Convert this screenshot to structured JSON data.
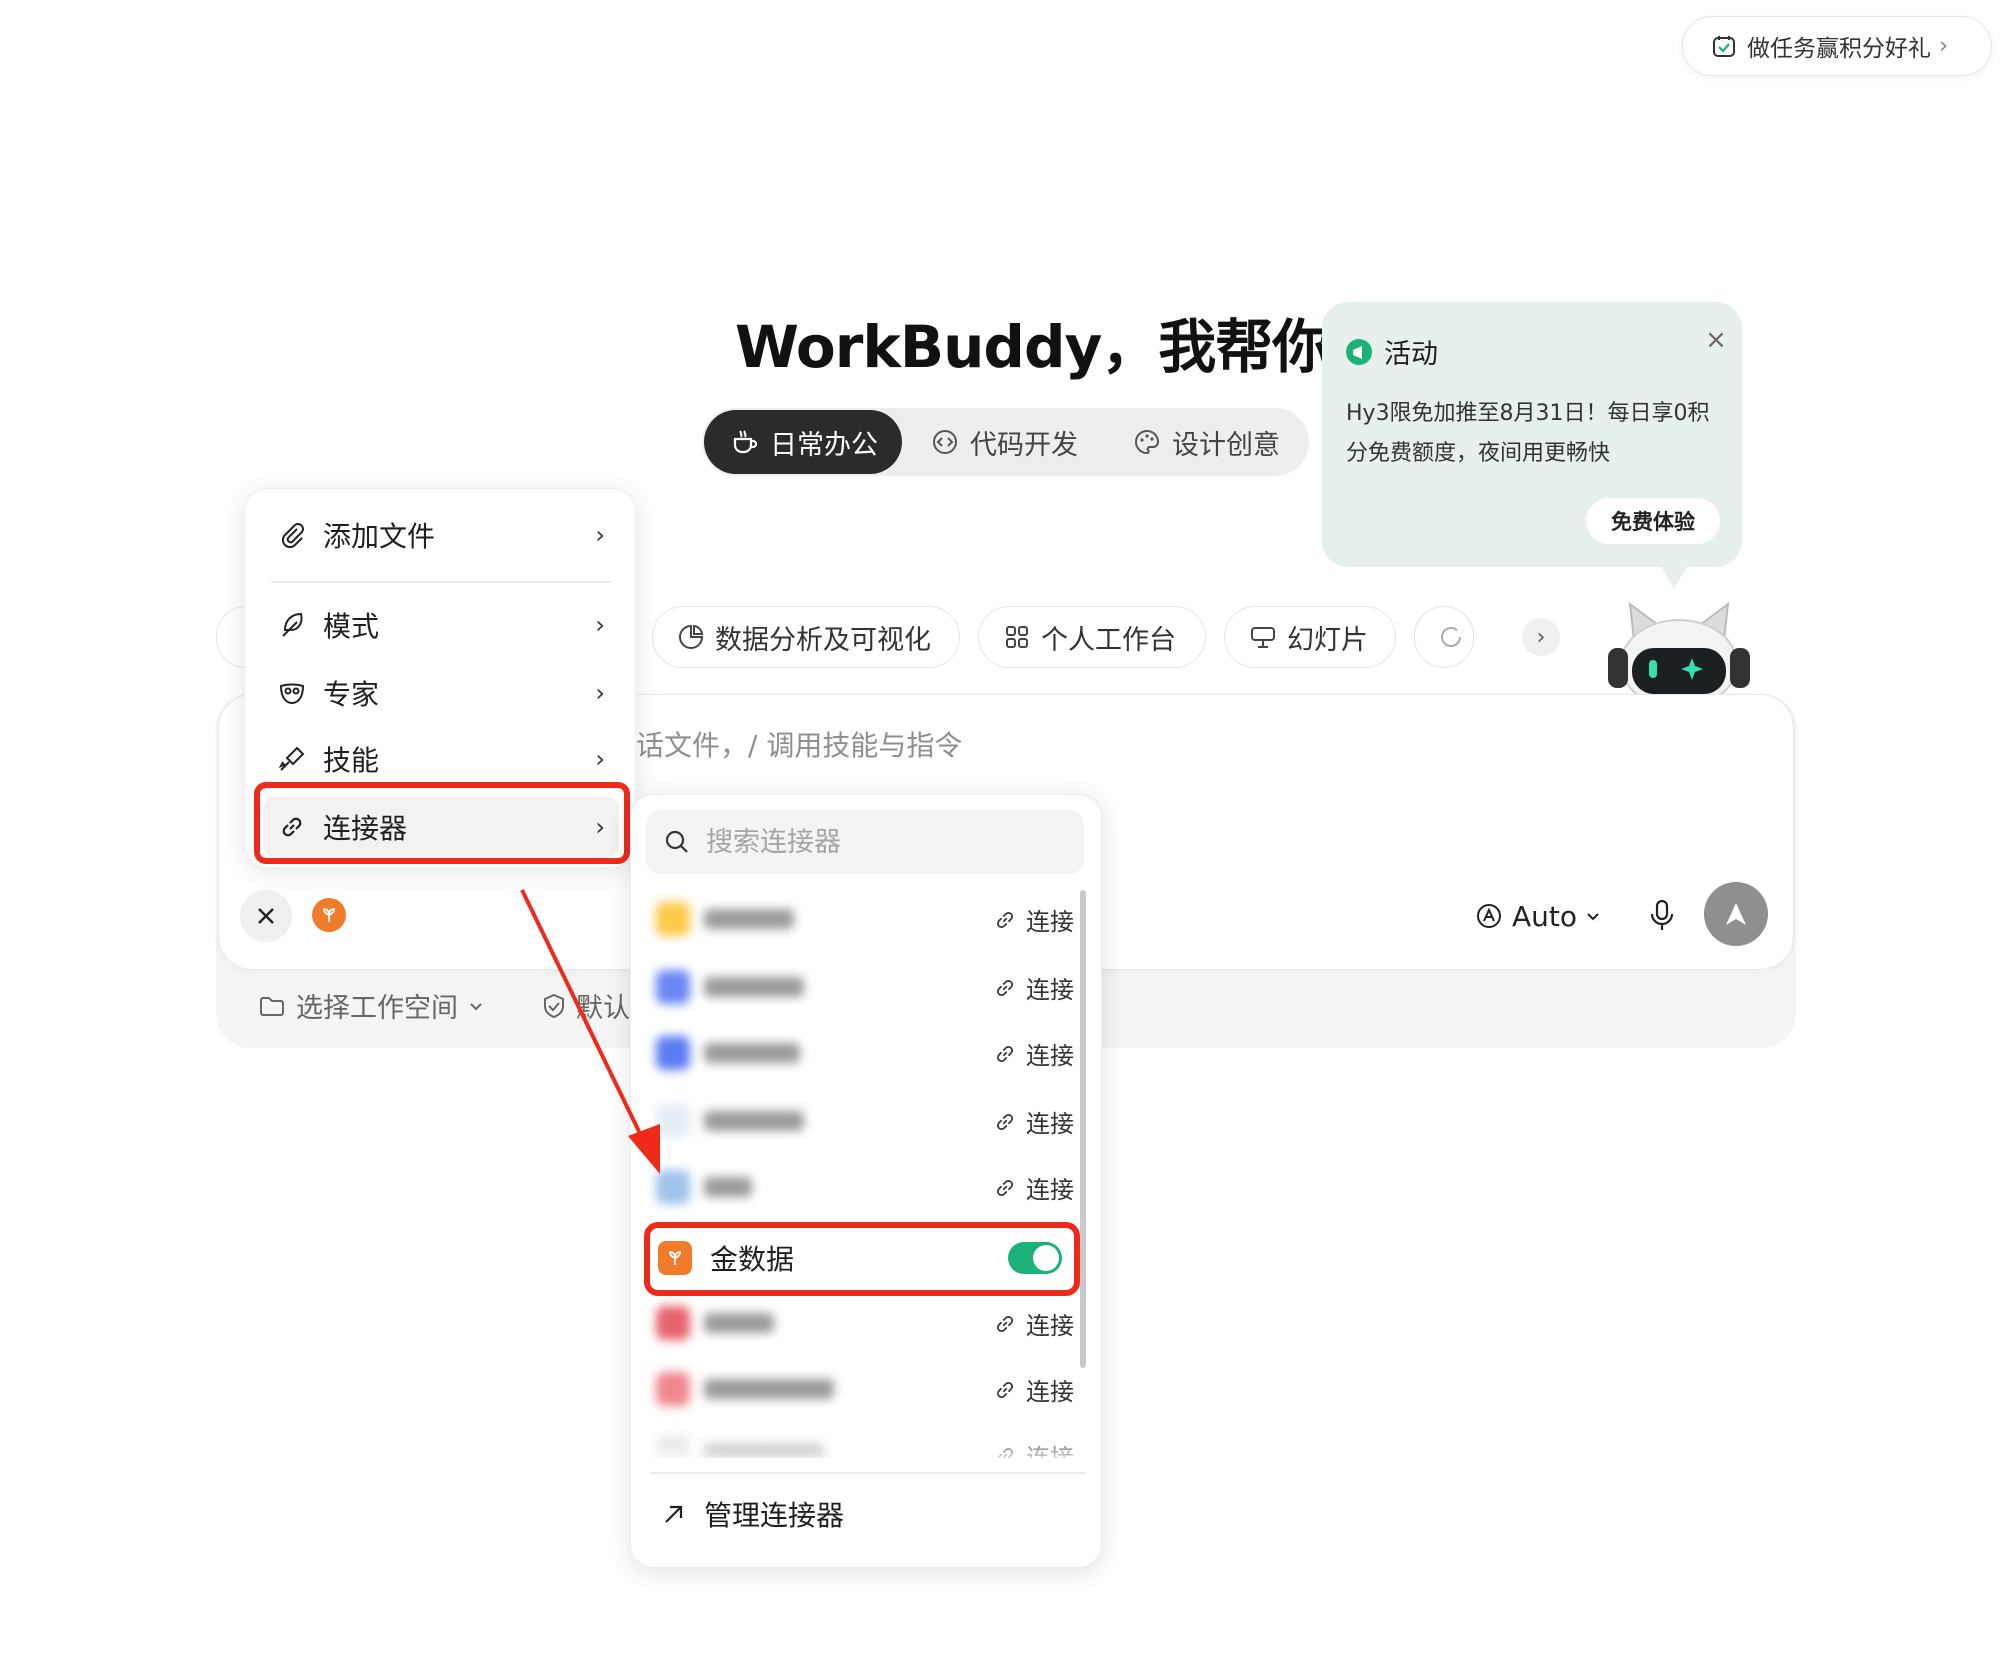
{
  "task_pill": {
    "label": "做任务赢积分好礼"
  },
  "title": "WorkBuddy，我帮你",
  "mode_tabs": [
    {
      "label": "日常办公",
      "active": true,
      "icon": "coffee-cup-icon"
    },
    {
      "label": "代码开发",
      "active": false,
      "icon": "code-icon"
    },
    {
      "label": "设计创意",
      "active": false,
      "icon": "palette-icon"
    }
  ],
  "activity": {
    "title": "活动",
    "body": "Hy3限免加推至8月31日！每日享0积分免费额度，夜间用更畅快",
    "button": "免费体验",
    "close": "×"
  },
  "skill_chips": [
    {
      "label": "数据分析及可视化",
      "icon": "pie-chart-icon"
    },
    {
      "label": "个人工作台",
      "icon": "grid-icon"
    },
    {
      "label": "幻灯片",
      "icon": "presentation-icon"
    }
  ],
  "input": {
    "placeholder": "话文件，/ 调用技能与指令",
    "model": "Auto"
  },
  "footer": {
    "workspace": "选择工作空间",
    "permission": "默认"
  },
  "attach_menu": {
    "items": [
      {
        "label": "添加文件",
        "icon": "paperclip-icon"
      },
      {
        "label": "模式",
        "icon": "feather-icon"
      },
      {
        "label": "专家",
        "icon": "mask-icon"
      },
      {
        "label": "技能",
        "icon": "skill-icon"
      },
      {
        "label": "连接器",
        "icon": "link-icon"
      }
    ]
  },
  "connector_panel": {
    "search_placeholder": "搜索连接器",
    "connect_label": "连接",
    "active_connector": {
      "name": "金数据",
      "enabled": true
    },
    "manage_label": "管理连接器"
  },
  "colors": {
    "accent_red": "#ee2a1b",
    "toggle_on": "#1bb279",
    "connector_orange": "#f07b2b",
    "activity_bg": "#e6f0ee"
  }
}
